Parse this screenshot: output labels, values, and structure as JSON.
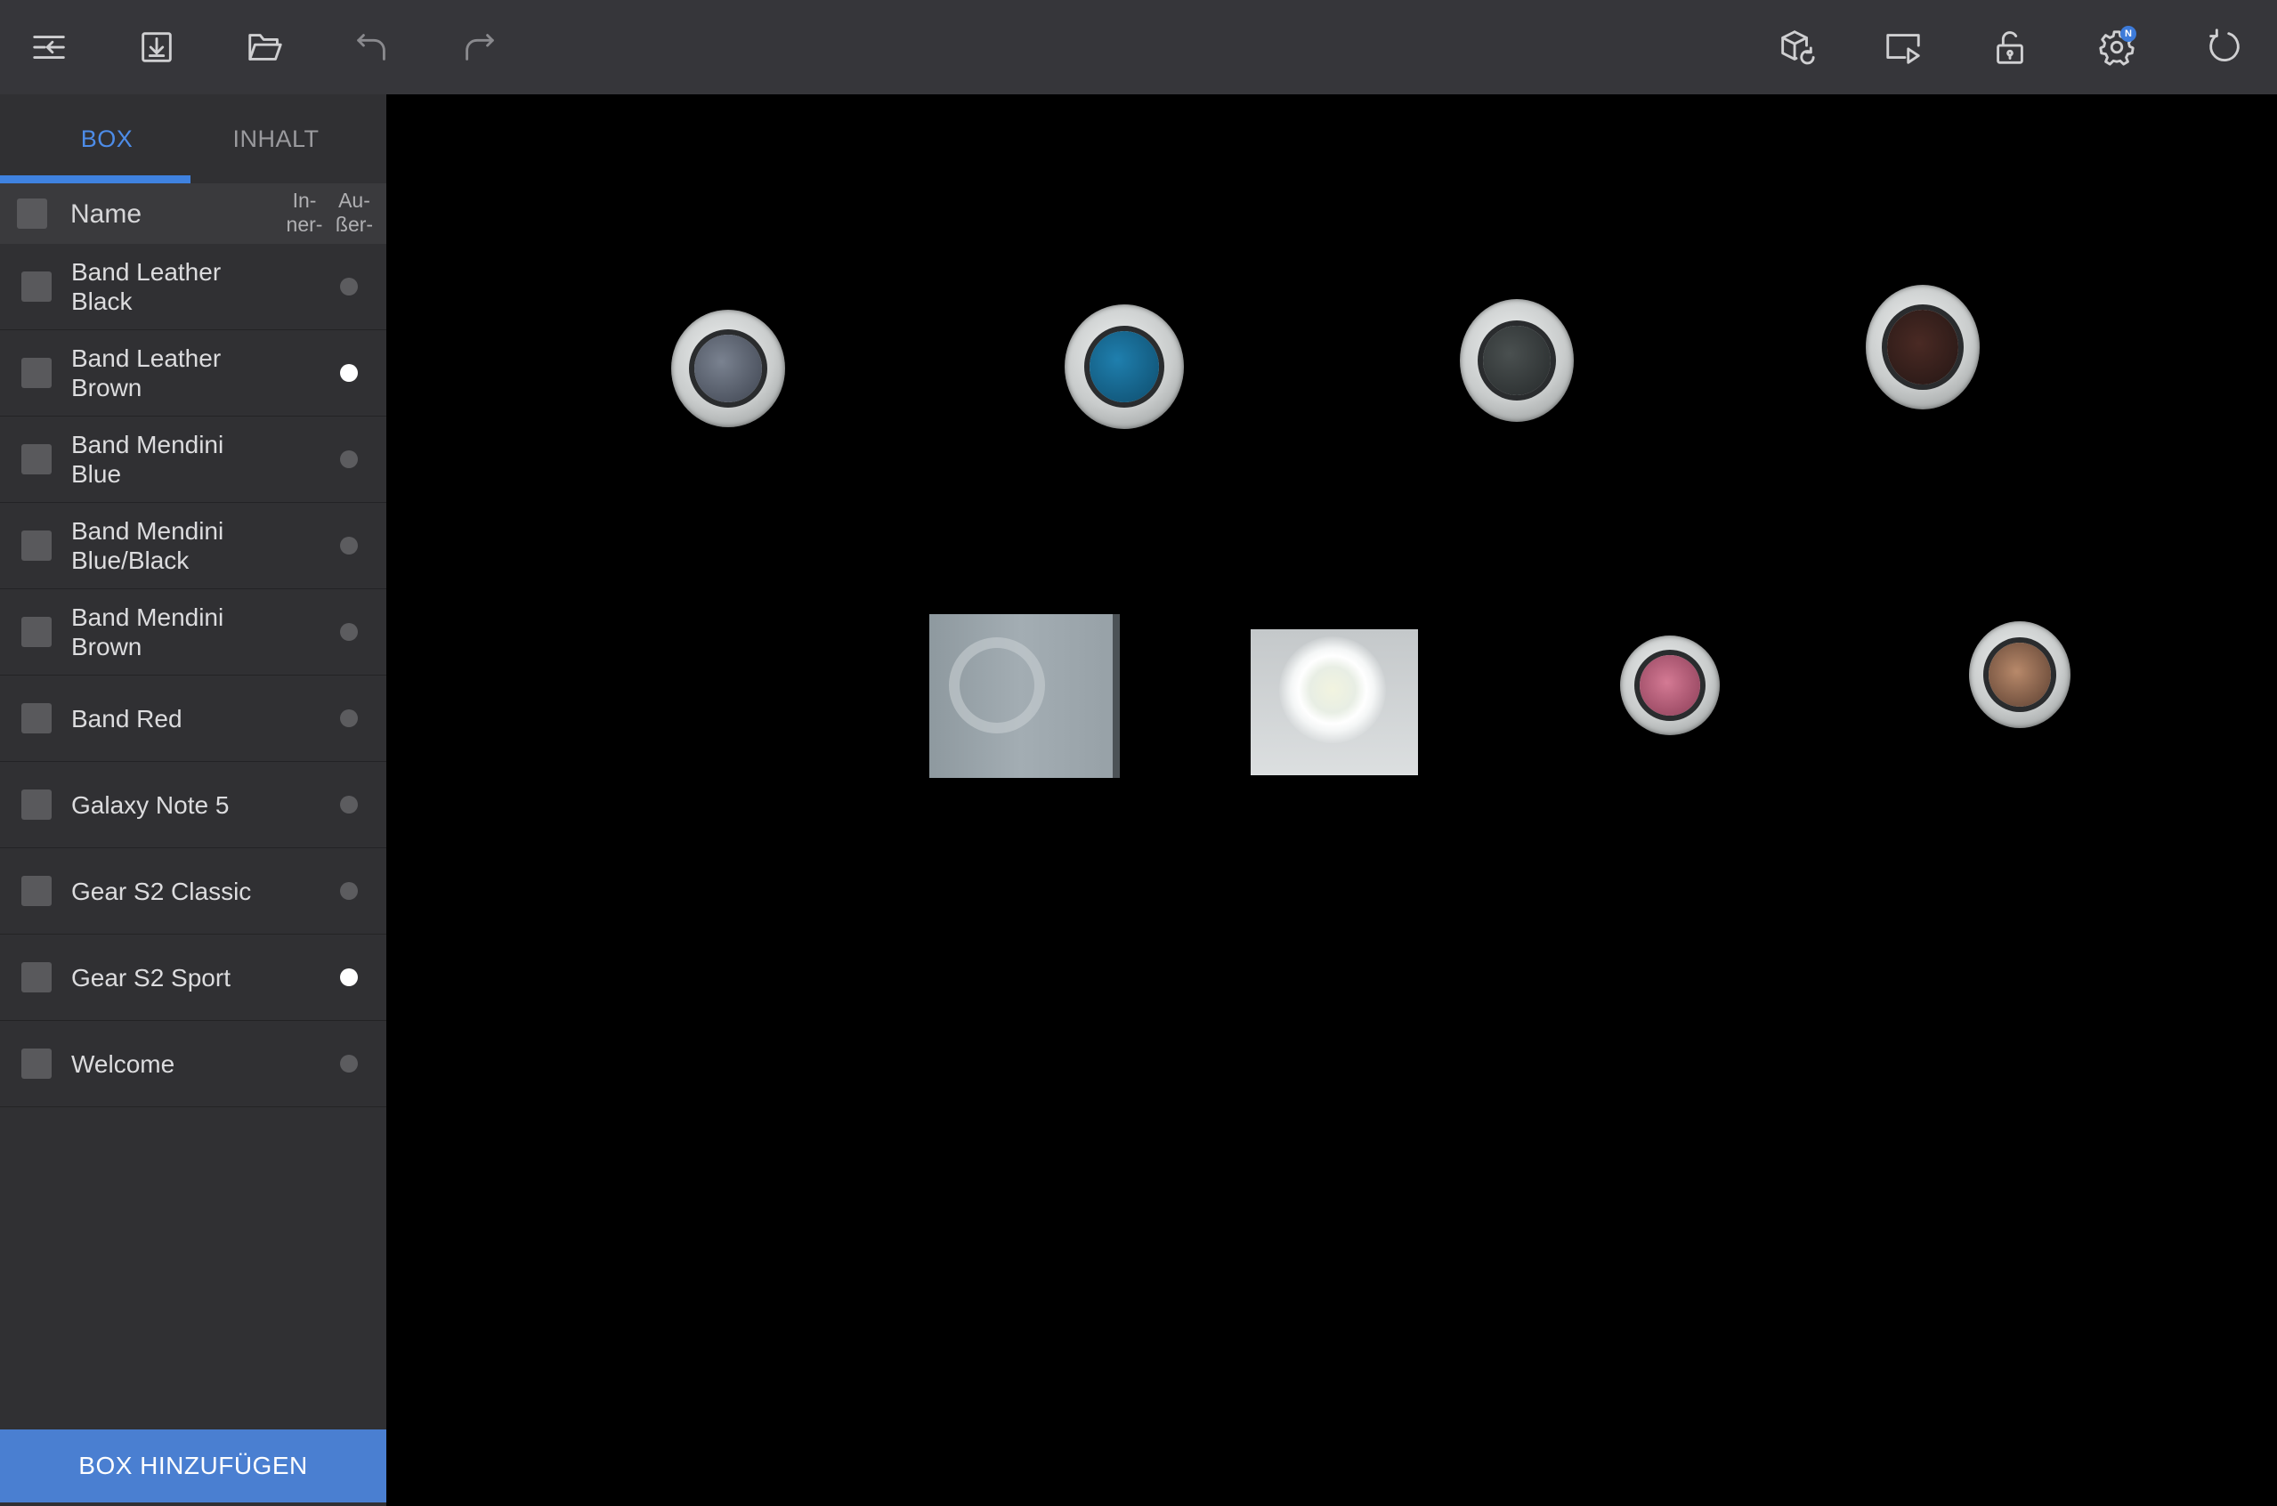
{
  "toolbar": {
    "left_icons": [
      "collapse-menu-icon",
      "download-icon",
      "folder-open-icon",
      "undo-icon",
      "redo-icon"
    ],
    "right_icons": [
      "cube-refresh-icon",
      "play-screen-icon",
      "unlock-icon",
      "gear-icon",
      "refresh-icon"
    ],
    "settings_badge": "N"
  },
  "sidebar": {
    "tabs": [
      {
        "label": "BOX",
        "active": true
      },
      {
        "label": "INHALT",
        "active": false
      }
    ],
    "header": {
      "name": "Name",
      "col_inner": "In-\nner-",
      "col_outer": "Au-\nßer-"
    },
    "items": [
      {
        "label": "Band Leather Black",
        "active": false
      },
      {
        "label": "Band Leather Brown",
        "active": true
      },
      {
        "label": "Band Mendini Blue",
        "active": false
      },
      {
        "label": "Band Mendini Blue/Black",
        "active": false
      },
      {
        "label": "Band Mendini Brown",
        "active": false
      },
      {
        "label": "Band Red",
        "active": false
      },
      {
        "label": "Galaxy Note 5",
        "active": false
      },
      {
        "label": "Gear S2 Classic",
        "active": false
      },
      {
        "label": "Gear S2 Sport",
        "active": true
      },
      {
        "label": "Welcome",
        "active": false
      }
    ],
    "add_button": "BOX HINZUFÜGEN"
  },
  "colors": {
    "accent": "#4a7fd1",
    "toolbar_bg": "#36363a",
    "sidebar_bg": "#303033",
    "canvas_bg": "#000000"
  }
}
